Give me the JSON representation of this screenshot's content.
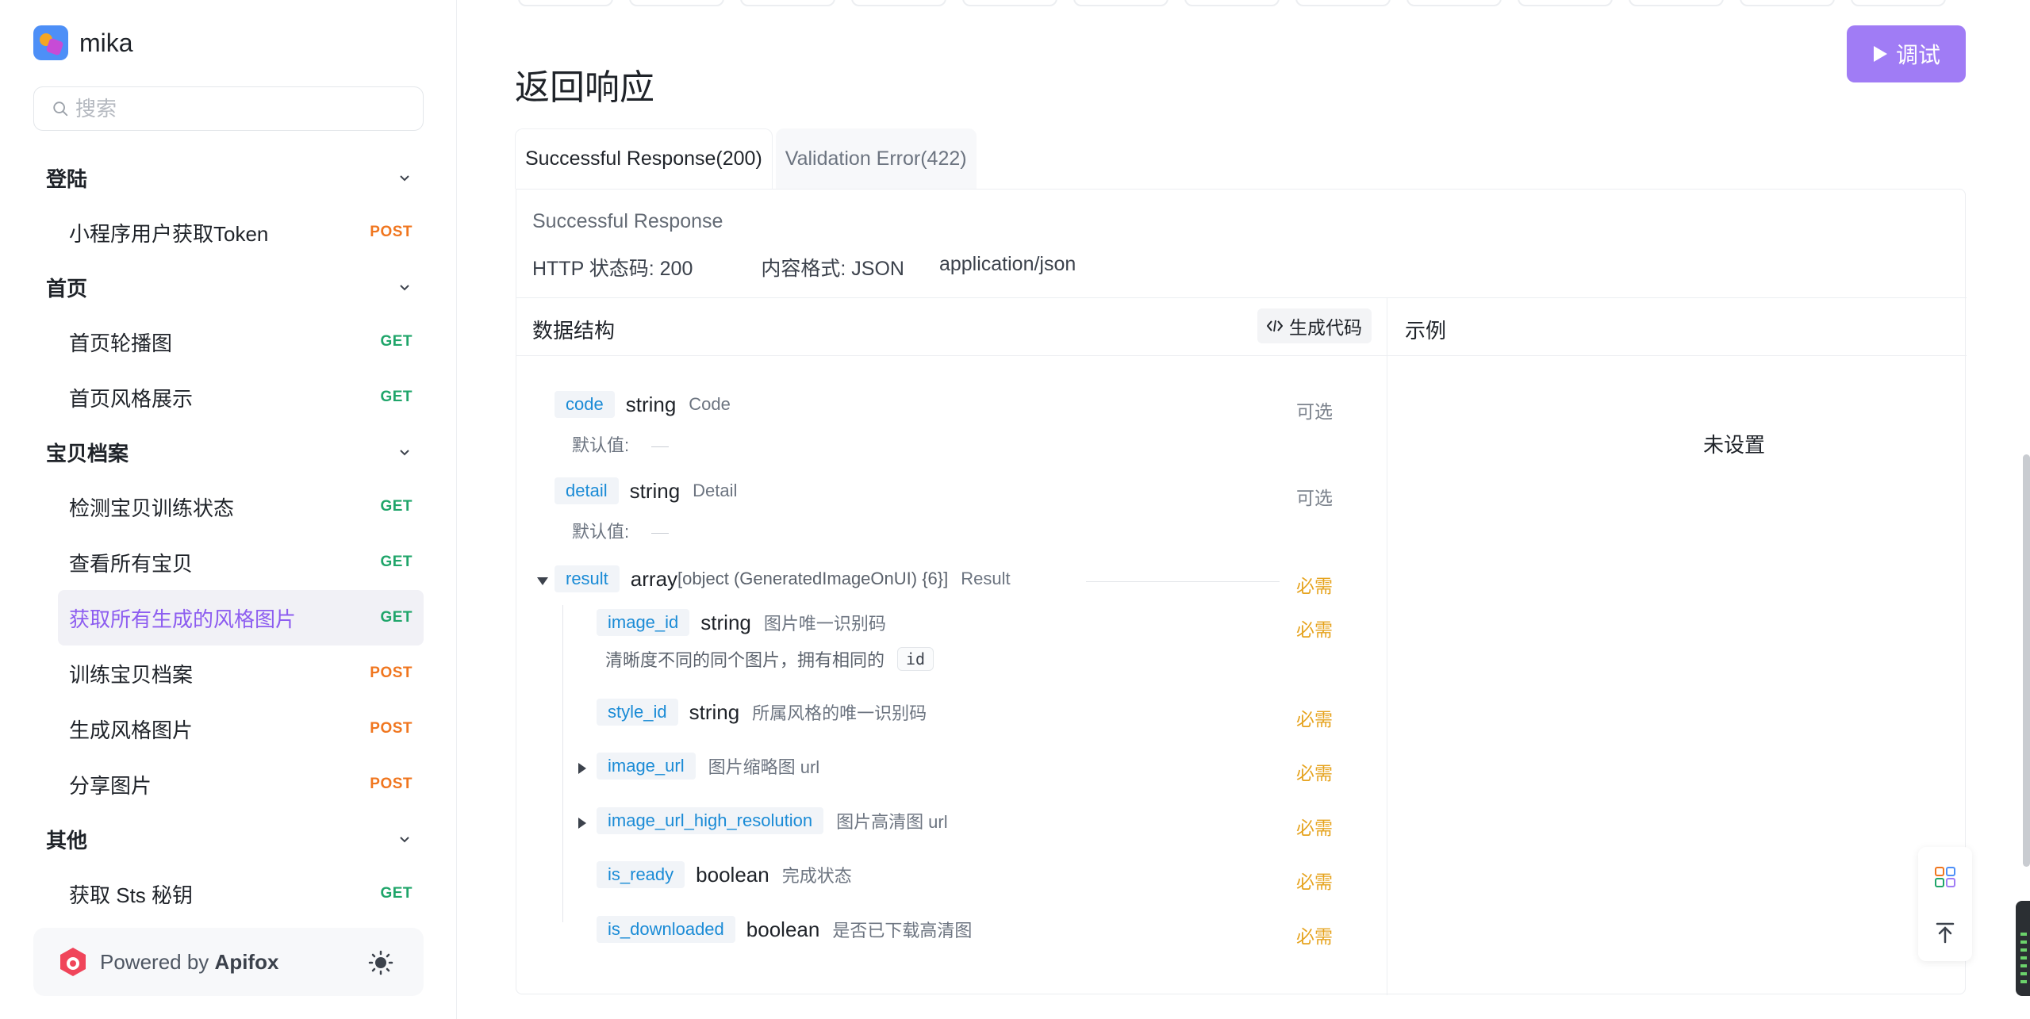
{
  "brand": {
    "name": "mika"
  },
  "search": {
    "placeholder": "搜索"
  },
  "sidebar": {
    "groups": [
      {
        "title": "登陆",
        "items": [
          {
            "label": "小程序用户获取Token",
            "method": "POST"
          }
        ]
      },
      {
        "title": "首页",
        "items": [
          {
            "label": "首页轮播图",
            "method": "GET"
          },
          {
            "label": "首页风格展示",
            "method": "GET"
          }
        ]
      },
      {
        "title": "宝贝档案",
        "items": [
          {
            "label": "检测宝贝训练状态",
            "method": "GET"
          },
          {
            "label": "查看所有宝贝",
            "method": "GET"
          },
          {
            "label": "获取所有生成的风格图片",
            "method": "GET",
            "active": true
          },
          {
            "label": "训练宝贝档案",
            "method": "POST"
          },
          {
            "label": "生成风格图片",
            "method": "POST"
          },
          {
            "label": "分享图片",
            "method": "POST"
          }
        ]
      },
      {
        "title": "其他",
        "items": [
          {
            "label": "获取 Sts 秘钥",
            "method": "GET"
          }
        ]
      }
    ]
  },
  "footer": {
    "powered_prefix": "Powered by",
    "powered_brand": "Apifox"
  },
  "toolbar": {
    "debug_label": "调试"
  },
  "section": {
    "title": "返回响应"
  },
  "tabs": [
    {
      "label": "Successful Response(200)",
      "active": true
    },
    {
      "label": "Validation Error(422)",
      "active": false
    }
  ],
  "response": {
    "description": "Successful Response",
    "status": "HTTP 状态码: 200",
    "format": "内容格式: JSON",
    "content_type": "application/json"
  },
  "schema": {
    "title": "数据结构",
    "gen_code_label": "生成代码",
    "example_title": "示例",
    "example_value": "未设置",
    "default_label": "默认值:",
    "fields": {
      "code": {
        "name": "code",
        "type": "string",
        "title": "Code",
        "req": "可选"
      },
      "detail": {
        "name": "detail",
        "type": "string",
        "title": "Detail",
        "req": "可选"
      },
      "result": {
        "name": "result",
        "type": "array",
        "subtype": "[object (GeneratedImageOnUI) {6}]",
        "title": "Result",
        "req": "必需"
      },
      "image_id": {
        "name": "image_id",
        "type": "string",
        "title": "图片唯一识别码",
        "req": "必需",
        "note": "清晰度不同的同个图片，拥有相同的",
        "code": "id"
      },
      "style_id": {
        "name": "style_id",
        "type": "string",
        "title": "所属风格的唯一识别码",
        "req": "必需"
      },
      "image_url": {
        "name": "image_url",
        "title": "图片缩略图 url",
        "req": "必需"
      },
      "image_url_high_resolution": {
        "name": "image_url_high_resolution",
        "title": "图片高清图 url",
        "req": "必需"
      },
      "is_ready": {
        "name": "is_ready",
        "type": "boolean",
        "title": "完成状态",
        "req": "必需"
      },
      "is_downloaded": {
        "name": "is_downloaded",
        "type": "boolean",
        "title": "是否已下载高清图",
        "req": "必需"
      }
    }
  },
  "colors": {
    "accent": "#a07cf5",
    "active_text": "#8d5df0",
    "post": "#f0761f",
    "get": "#1fa56a",
    "required": "#e6a31e",
    "field_name": "#1a8bd6"
  }
}
